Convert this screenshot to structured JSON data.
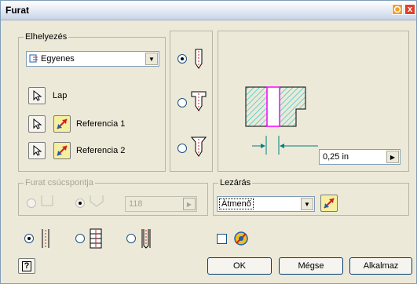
{
  "window": {
    "title": "Furat",
    "close_glyph": "x"
  },
  "placement": {
    "legend": "Elhelyezés",
    "mode_value": "Egyenes",
    "face_label": "Lap",
    "ref1_label": "Referencia 1",
    "ref2_label": "Referencia 2"
  },
  "diameter": {
    "value": "0,25 in"
  },
  "tip": {
    "legend": "Furat csúcspontja",
    "angle_value": "118"
  },
  "termination": {
    "legend": "Lezárás",
    "value": "Átmenő"
  },
  "buttons": {
    "ok": "OK",
    "cancel": "Mégse",
    "apply": "Alkalmaz",
    "help": "?"
  },
  "colors": {
    "hatch": "#33cccc",
    "hole": "#ff00ff",
    "dimension": "#008080"
  }
}
